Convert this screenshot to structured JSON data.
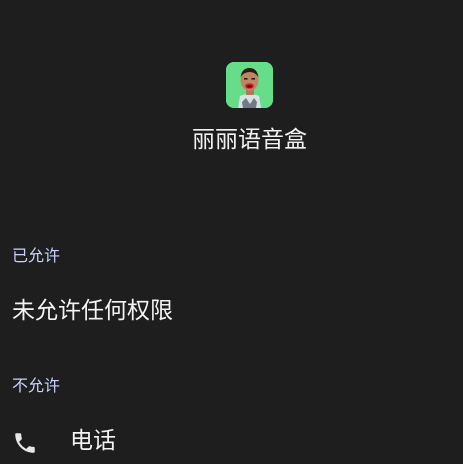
{
  "app": {
    "name": "丽丽语音盒",
    "icon": "app-icon-portrait",
    "icon_bg": "#66dd88"
  },
  "sections": {
    "allowed": {
      "header": "已允许",
      "empty_text": "未允许任何权限"
    },
    "denied": {
      "header": "不允许",
      "items": [
        {
          "icon": "phone-icon",
          "label": "电话"
        }
      ]
    }
  },
  "colors": {
    "background": "#1e1e1f",
    "header_text": "#c8d3ff",
    "primary_text": "#f3f3f3"
  }
}
